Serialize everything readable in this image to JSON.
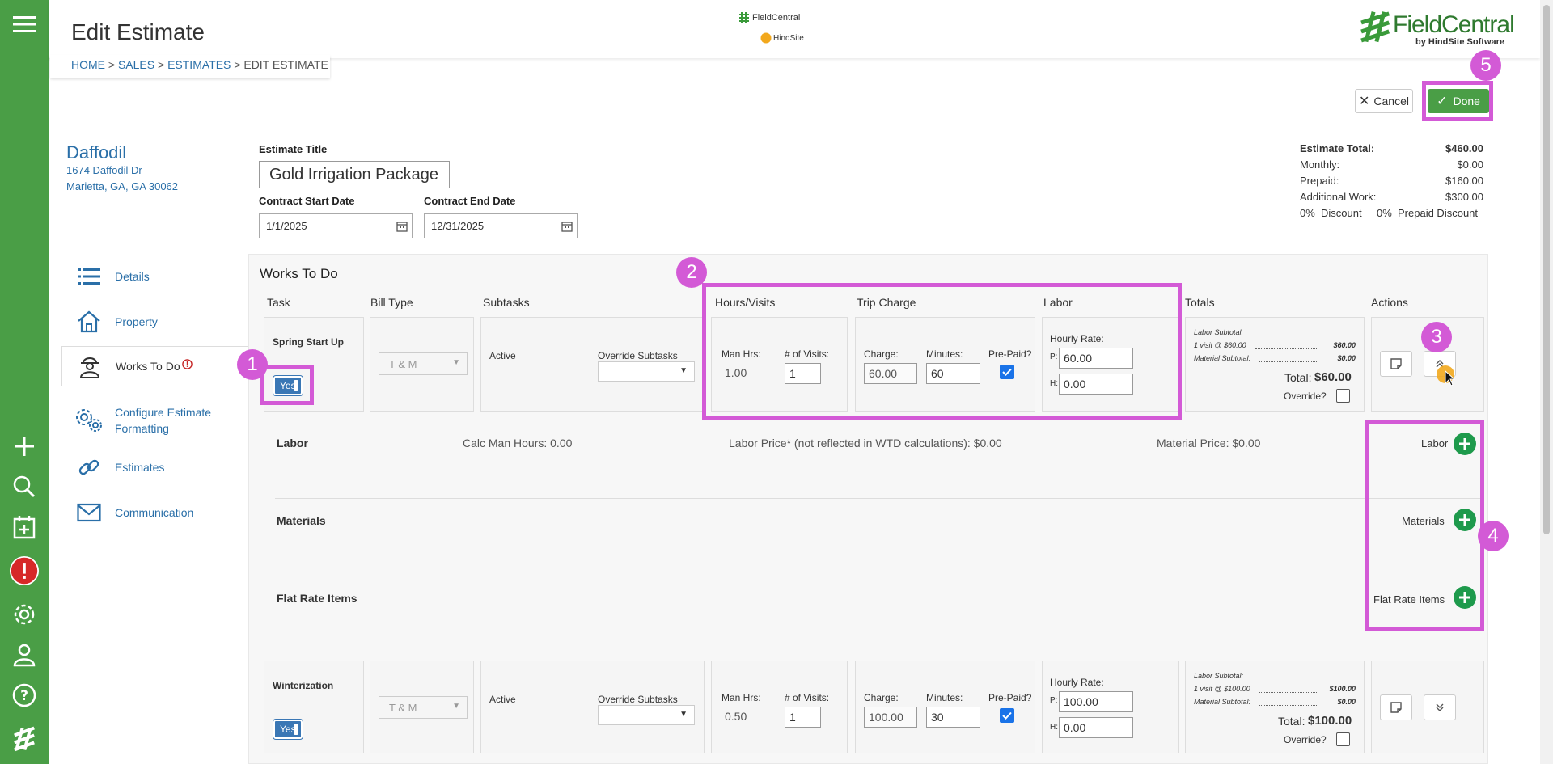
{
  "header": {
    "title": "Edit Estimate",
    "breadcrumb": {
      "home": "HOME",
      "sales": "SALES",
      "estimates": "ESTIMATES",
      "current": "EDIT ESTIMATE",
      "sep": ">"
    },
    "center_logo_top": "FieldCentral",
    "center_logo_bottom": "HindSite",
    "brand_name": "FieldCentral",
    "brand_tagline": "by HindSite Software"
  },
  "actions": {
    "cancel": "Cancel",
    "done": "Done"
  },
  "customer": {
    "name": "Daffodil",
    "address1": "1674 Daffodil Dr",
    "address2": "Marietta, GA, GA 30062"
  },
  "form": {
    "estimate_title_label": "Estimate Title",
    "estimate_title_value": "Gold Irrigation Package",
    "start_label": "Contract Start Date",
    "start_value": "1/1/2025",
    "end_label": "Contract End Date",
    "end_value": "12/31/2025"
  },
  "summary": {
    "total_label": "Estimate Total:",
    "total_value": "$460.00",
    "monthly_label": "Monthly:",
    "monthly_value": "$0.00",
    "prepaid_label": "Prepaid:",
    "prepaid_value": "$160.00",
    "additional_label": "Additional Work:",
    "additional_value": "$300.00",
    "discount": "0%  Discount",
    "prepaid_discount": "0%  Prepaid Discount"
  },
  "nav": {
    "details": "Details",
    "property": "Property",
    "works": "Works To Do",
    "configure1": "Configure Estimate",
    "configure2": "Formatting",
    "estimates": "Estimates",
    "communication": "Communication"
  },
  "works": {
    "heading": "Works To Do",
    "columns": {
      "task": "Task",
      "bill_type": "Bill Type",
      "subtasks": "Subtasks",
      "hours": "Hours/Visits",
      "trip": "Trip Charge",
      "labor": "Labor",
      "totals": "Totals",
      "actions": "Actions"
    },
    "rows": [
      {
        "task": "Spring Start Up",
        "toggle": "Yes",
        "bill_type": "T & M",
        "status": "Active",
        "override_label": "Override Subtasks",
        "man_hrs_label": "Man Hrs:",
        "man_hrs": "1.00",
        "visits_label": "# of Visits:",
        "visits": "1",
        "charge_label": "Charge:",
        "charge": "60.00",
        "minutes_label": "Minutes:",
        "minutes": "60",
        "prepaid_label": "Pre-Paid?",
        "rate_label": "Hourly Rate:",
        "p_label": "P:",
        "p_value": "60.00",
        "h_label": "H:",
        "h_value": "0.00",
        "labor_subtotal_label": "Labor Subtotal:",
        "visit_line": "1 visit @ $60.00",
        "visit_amount": "$60.00",
        "material_subtotal_label": "Material Subtotal:",
        "material_amount": "$0.00",
        "total_label": "Total:",
        "total": "$60.00",
        "override_q": "Override?"
      },
      {
        "task": "Winterization",
        "toggle": "Yes",
        "bill_type": "T & M",
        "status": "Active",
        "override_label": "Override Subtasks",
        "man_hrs_label": "Man Hrs:",
        "man_hrs": "0.50",
        "visits_label": "# of Visits:",
        "visits": "1",
        "charge_label": "Charge:",
        "charge": "100.00",
        "minutes_label": "Minutes:",
        "minutes": "30",
        "prepaid_label": "Pre-Paid?",
        "rate_label": "Hourly Rate:",
        "p_label": "P:",
        "p_value": "100.00",
        "h_label": "H:",
        "h_value": "0.00",
        "labor_subtotal_label": "Labor Subtotal:",
        "visit_line": "1 visit @ $100.00",
        "visit_amount": "$100.00",
        "material_subtotal_label": "Material Subtotal:",
        "material_amount": "$0.00",
        "total_label": "Total:",
        "total": "$100.00",
        "override_q": "Override?"
      }
    ],
    "expanded": {
      "labor_title": "Labor",
      "calc_man_hours": "Calc Man Hours: 0.00",
      "labor_price": "Labor Price* (not reflected in WTD calculations): $0.00",
      "material_price": "Material Price: $0.00",
      "materials_title": "Materials",
      "flat_title": "Flat Rate Items",
      "add_labor": "Labor",
      "add_materials": "Materials",
      "add_flat": "Flat Rate Items"
    }
  },
  "callouts": [
    "1",
    "2",
    "3",
    "4",
    "5"
  ],
  "colors": {
    "rail": "#4a9e46",
    "link": "#2a6fa8",
    "done": "#4a9e46",
    "highlight": "#d35ad6",
    "add": "#1e9a4c"
  }
}
